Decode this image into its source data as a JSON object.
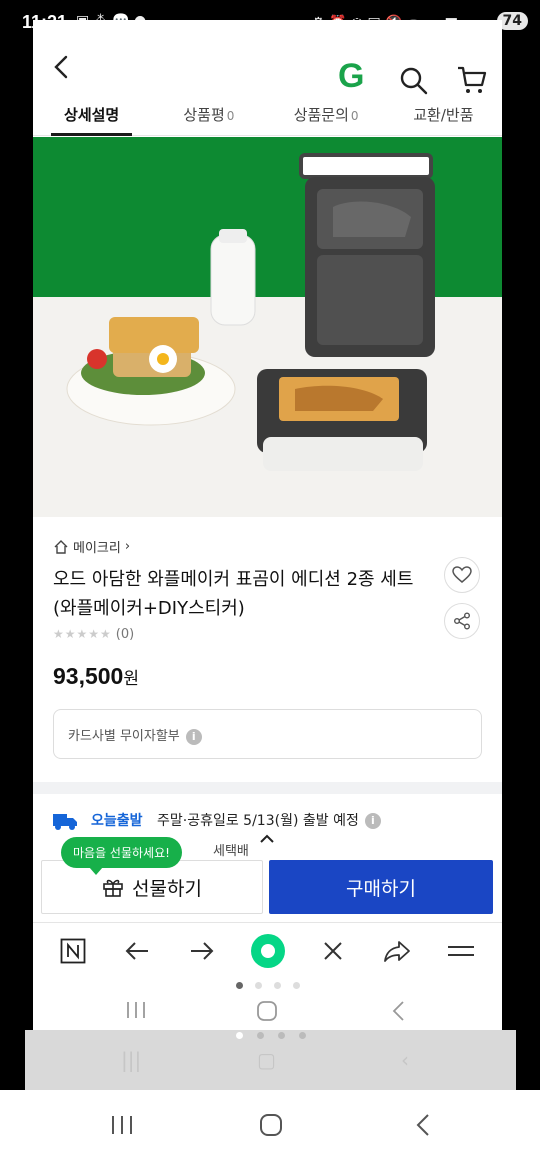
{
  "status": {
    "time": "11:21",
    "battery": "74"
  },
  "header": {
    "logo": "G"
  },
  "tabs": [
    {
      "label": "상세설명",
      "count": ""
    },
    {
      "label": "상품평",
      "count": "0"
    },
    {
      "label": "상품문의",
      "count": "0"
    },
    {
      "label": "교환/반품",
      "count": ""
    }
  ],
  "product": {
    "brand": "메이크리",
    "title": "오드 아담한 와플메이커 표곰이 에디션 2종 세트 (와플메이커+DIY스티커)",
    "stars": "★★★★★",
    "rating_count": "(0)",
    "price": "93,500",
    "price_unit": "원",
    "card_text": "카드사별 무이자할부"
  },
  "shipping": {
    "today_label": "오늘출발",
    "desc": "주말·공휴일로 5/13(월) 출발 예정",
    "extra": "세택배"
  },
  "actions": {
    "gift_bubble": "마음을 선물하세요!",
    "gift_label": "선물하기",
    "buy_label": "구매하기"
  },
  "colors": {
    "brand_green": "#1aa34a",
    "buy_blue": "#1a46c4",
    "ship_blue": "#1565d8"
  }
}
